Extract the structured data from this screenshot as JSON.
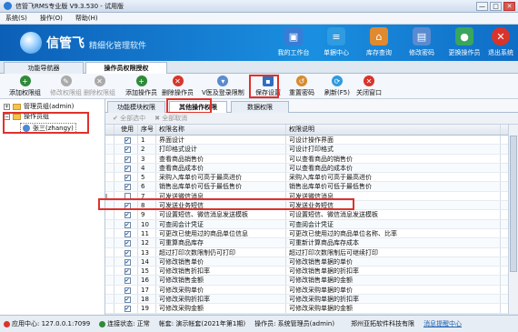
{
  "window": {
    "title": "信管飞RMS专业版 V9.3.530 - 试用版",
    "btn_min": "—",
    "btn_max": "□",
    "btn_close": "✕"
  },
  "menu": [
    "系统(S)",
    "操作(O)",
    "帮助(H)"
  ],
  "banner": {
    "logo_name": "信管飞",
    "slogan": "精细化管理软件",
    "nav": [
      {
        "label": "我的工作台",
        "icon": "desk-icon",
        "color": "#3a7bd5"
      },
      {
        "label": "单据中心",
        "icon": "doc-icon",
        "color": "#2f9be0"
      },
      {
        "label": "库存查询",
        "icon": "stock-icon",
        "color": "#e08a2f"
      },
      {
        "label": "修改密码",
        "icon": "lock-icon",
        "color": "#5a8bd0"
      },
      {
        "label": "更换操作员",
        "icon": "user-icon",
        "color": "#3aa55c"
      },
      {
        "label": "退出系统",
        "icon": "exit-icon",
        "color": "#d9342b"
      }
    ]
  },
  "main_tabs": [
    "功能导航器",
    "操作员权限授权"
  ],
  "toolbar": [
    {
      "label": "添加权限组",
      "icon": "add-icon",
      "color": "#2f8a3a",
      "enabled": true
    },
    {
      "label": "修改权限组",
      "icon": "edit-icon",
      "color": "#aaa",
      "enabled": false
    },
    {
      "label": "删除权限组",
      "icon": "delete-icon",
      "color": "#aaa",
      "enabled": false
    },
    {
      "label": "添加操作员",
      "icon": "add-user-icon",
      "color": "#2f8a3a",
      "enabled": true
    },
    {
      "label": "删除操作员",
      "icon": "delete-user-icon",
      "color": "#d9342b",
      "enabled": true
    },
    {
      "label": "V医及登录限制",
      "icon": "limit-icon",
      "color": "#5a8bd0",
      "enabled": true
    },
    {
      "label": "保存设置",
      "icon": "save-icon",
      "color": "#2f6fbf",
      "enabled": true
    },
    {
      "label": "重置密码",
      "icon": "reset-icon",
      "color": "#d98a2a",
      "enabled": true
    },
    {
      "label": "刷新(F5)",
      "icon": "refresh-icon",
      "color": "#2f9be0",
      "enabled": true
    },
    {
      "label": "关闭窗口",
      "icon": "close-icon",
      "color": "#d9342b",
      "enabled": true
    }
  ],
  "tree": {
    "admin_group": "管理员组(admin)",
    "operator_group": "操作员组",
    "operator": "张三(zhangy)"
  },
  "perm_tabs": [
    "功能模块权限",
    "其他操作权限",
    "数据权限"
  ],
  "subbar": {
    "select_all": "全部选中",
    "cancel_all": "全部取消"
  },
  "grid": {
    "headers": [
      "使用",
      "序号",
      "权限名称",
      "权限说明"
    ],
    "rows": [
      {
        "use": true,
        "no": "1",
        "name": "界面设计",
        "desc": "可设计操作界面"
      },
      {
        "use": true,
        "no": "2",
        "name": "打印格式设计",
        "desc": "可设计打印格式"
      },
      {
        "use": true,
        "no": "3",
        "name": "查看商品销售价",
        "desc": "可以查看商品的销售价"
      },
      {
        "use": true,
        "no": "4",
        "name": "查看商品成本价",
        "desc": "可以查看商品的成本价"
      },
      {
        "use": true,
        "no": "5",
        "name": "采购入库单价可高于最高进价",
        "desc": "采购入库单价可高于最高进价"
      },
      {
        "use": true,
        "no": "6",
        "name": "销售出库单价可低于最低售价",
        "desc": "销售出库单价可低于最低售价"
      },
      {
        "use": false,
        "no": "7",
        "name": "可发送微信消息",
        "desc": "可发送微信消息"
      },
      {
        "use": true,
        "no": "8",
        "name": "可发送业务短信",
        "desc": "可发送业务短信"
      },
      {
        "use": true,
        "no": "9",
        "name": "可设置短信、微信消息发送模板",
        "desc": "可设置短信、微信消息发送模板"
      },
      {
        "use": true,
        "no": "10",
        "name": "可查阅会计凭证",
        "desc": "可查阅会计凭证"
      },
      {
        "use": true,
        "no": "11",
        "name": "可更改已使用过的商品单位信息",
        "desc": "可更改已使用过的商品单位名称、比率"
      },
      {
        "use": true,
        "no": "12",
        "name": "可重算商品库存",
        "desc": "可重新计算商品库存成本"
      },
      {
        "use": true,
        "no": "13",
        "name": "超过打印次数限制仍可打印",
        "desc": "超过打印次数限制后可继续打印"
      },
      {
        "use": true,
        "no": "14",
        "name": "可修改销售单价",
        "desc": "可修改销售单据的单价"
      },
      {
        "use": true,
        "no": "15",
        "name": "可修改销售折扣率",
        "desc": "可修改销售单据的折扣率"
      },
      {
        "use": true,
        "no": "16",
        "name": "可修改销售金额",
        "desc": "可修改销售单据的金额"
      },
      {
        "use": true,
        "no": "17",
        "name": "可修改采购单价",
        "desc": "可修改采购单据的单价"
      },
      {
        "use": true,
        "no": "18",
        "name": "可修改采购折扣率",
        "desc": "可修改采购单据的折扣率"
      },
      {
        "use": true,
        "no": "19",
        "name": "可修改采购金额",
        "desc": "可修改采购单据的金额"
      },
      {
        "use": true,
        "no": "20",
        "name": "可修改单据日期",
        "desc": "可修改单据日期"
      }
    ]
  },
  "status": {
    "app_center": "应用中心: 127.0.0.1:7099",
    "conn": "连接状态: 正常",
    "account": "帐套: 演示帐套(2021年第1期)",
    "operator": "操作员: 系统管理员(admin)",
    "company": "郑州亚拓软件科技有限",
    "message": "消息提醒中心"
  }
}
